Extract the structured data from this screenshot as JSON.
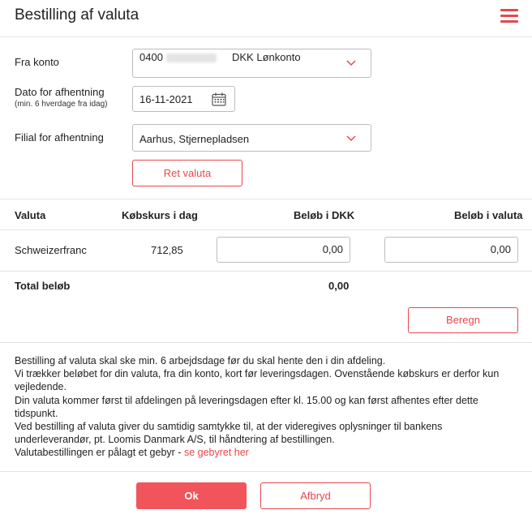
{
  "header": {
    "title": "Bestilling af valuta",
    "menu_icon": "hamburger-menu-icon"
  },
  "form": {
    "fra_konto_label": "Fra konto",
    "account_number": "0400",
    "account_name": "DKK Lønkonto",
    "dato_label": "Dato for afhentning",
    "dato_sublabel": "(min. 6 hverdage fra idag)",
    "date_value": "16-11-2021",
    "filial_label": "Filial for afhentning",
    "filial_value": "Aarhus, Stjernepladsen",
    "ret_valuta_button": "Ret valuta"
  },
  "table": {
    "headers": [
      "Valuta",
      "Købskurs i dag",
      "Beløb i DKK",
      "Beløb i valuta"
    ],
    "row": {
      "valuta": "Schweizerfranc",
      "kobskurs": "712,85",
      "belob_dkk": "0,00",
      "belob_valuta": "0,00"
    },
    "total_label": "Total beløb",
    "total_value": "0,00",
    "beregn_button": "Beregn"
  },
  "info": {
    "line1": "Bestilling af valuta skal ske min. 6 arbejdsdage før du skal hente den i din afdeling.",
    "line2": "Vi trækker beløbet for din valuta, fra din konto, kort før leveringsdagen. Ovenstående købskurs er derfor kun vejledende.",
    "line3": "Din valuta kommer først til afdelingen på leveringsdagen efter kl. 15.00 og kan først afhentes efter dette tidspunkt.",
    "line4": "Ved bestilling af valuta giver du samtidig samtykke til, at der videregives oplysninger til bankens underleverandør, pt. Loomis Danmark A/S, til håndtering af bestillingen.",
    "line5_prefix": "Valutabestillingen er pålagt et gebyr - ",
    "line5_link": "se gebyret her"
  },
  "footer": {
    "ok_button": "Ok",
    "cancel_button": "Afbryd"
  },
  "colors": {
    "accent": "#e5484d",
    "border": "#bdbdbd"
  }
}
